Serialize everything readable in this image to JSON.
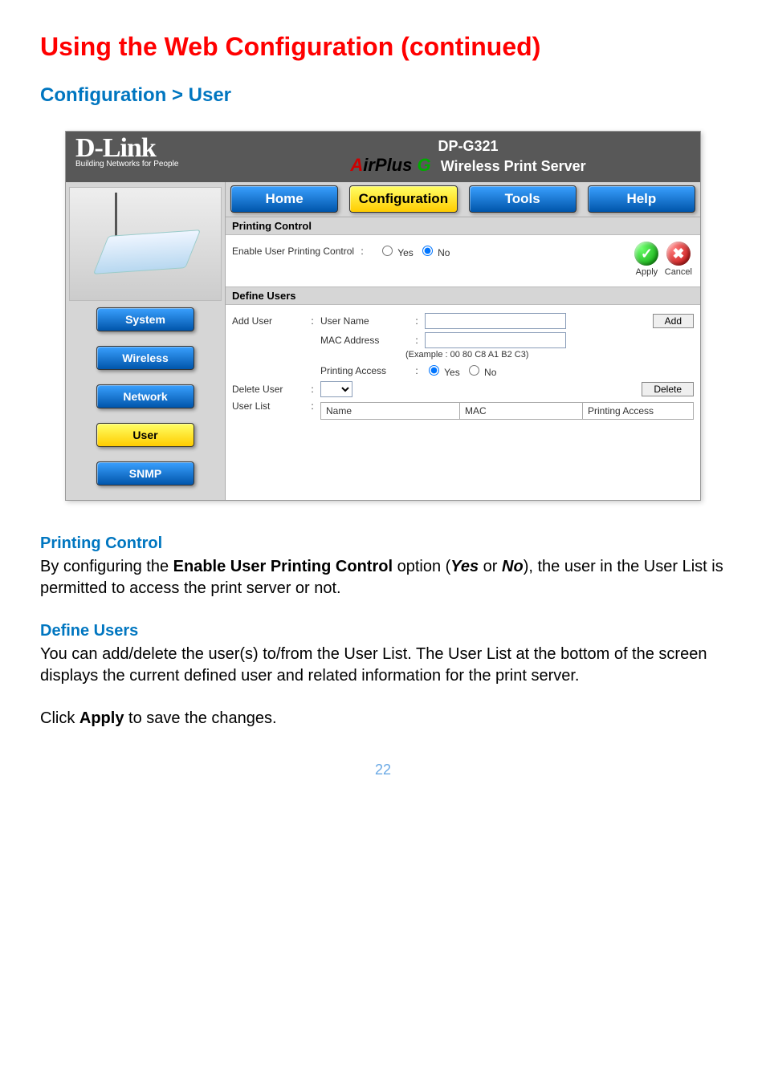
{
  "page": {
    "title": "Using the Web Configuration (continued)",
    "breadcrumb": "Configuration > User",
    "number": "22"
  },
  "header": {
    "logo_big": "D-Link",
    "logo_small": "Building Networks for People",
    "model": "DP-G321",
    "brand_a": "A",
    "brand_rest": "irPlus",
    "brand_g": " G",
    "wps": "Wireless Print Server"
  },
  "tabs": {
    "home": "Home",
    "configuration": "Configuration",
    "tools": "Tools",
    "help": "Help"
  },
  "sidebar": {
    "system": "System",
    "wireless": "Wireless",
    "network": "Network",
    "user": "User",
    "snmp": "SNMP"
  },
  "printing_control": {
    "section": "Printing Control",
    "enable_label": "Enable User Printing Control",
    "yes": "Yes",
    "no": "No",
    "apply": "Apply",
    "cancel": "Cancel"
  },
  "define_users": {
    "section": "Define Users",
    "add_user": "Add User",
    "user_name": "User Name",
    "mac_address": "MAC Address",
    "example": "(Example : 00 80 C8 A1 B2 C3)",
    "printing_access": "Printing Access",
    "yes": "Yes",
    "no": "No",
    "add_btn": "Add",
    "delete_user": "Delete User",
    "delete_btn": "Delete",
    "user_list": "User List",
    "col_name": "Name",
    "col_mac": "MAC",
    "col_access": "Printing Access"
  },
  "doc": {
    "pc_head": "Printing Control",
    "pc_text_1": "By configuring the ",
    "pc_bold_1": "Enable User Printing Control",
    "pc_text_2": " option (",
    "pc_ital_1": "Yes",
    "pc_text_3": " or ",
    "pc_ital_2": "No",
    "pc_text_4": "), the user in the User List is permitted to access the print server or not.",
    "du_head": "Define Users",
    "du_text": "You can add/delete the user(s) to/from the User List. The User List at the bottom of the screen displays the current defined user and related information for the print server.",
    "apply_1": "Click ",
    "apply_bold": "Apply",
    "apply_2": " to save the changes."
  }
}
